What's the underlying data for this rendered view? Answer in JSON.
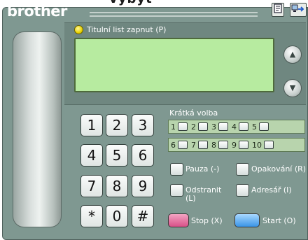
{
  "caption_fragment": "vybyt",
  "brand": "brother",
  "toolbar": {
    "address_book_icon": "document-icon",
    "connect_icon": "computer-arrow-icon"
  },
  "cover_page": {
    "label": "Titulní list zapnut (P)",
    "led_color": "#e8d200"
  },
  "lcd": {
    "text": "",
    "color": "#b7eba0"
  },
  "scroll": {
    "up_icon": "▲",
    "down_icon": "▼"
  },
  "keypad": {
    "keys": [
      "1",
      "2",
      "3",
      "4",
      "5",
      "6",
      "7",
      "8",
      "9",
      "*",
      "0",
      "#"
    ]
  },
  "speed_dial": {
    "title": "Krátká volba",
    "row1": [
      "1",
      "2",
      "3",
      "4",
      "5"
    ],
    "row2": [
      "6",
      "7",
      "8",
      "9",
      "10"
    ]
  },
  "functions": {
    "pause": "Pauza (-)",
    "redial": "Opakování (R)",
    "delete_line1": "Odstranit",
    "delete_line2": "(L)",
    "address_book": "Adresář (I)"
  },
  "actions": {
    "stop": "Stop (X)",
    "start": "Start (O)",
    "stop_color": "#e07098",
    "start_color": "#4fa8f0"
  }
}
